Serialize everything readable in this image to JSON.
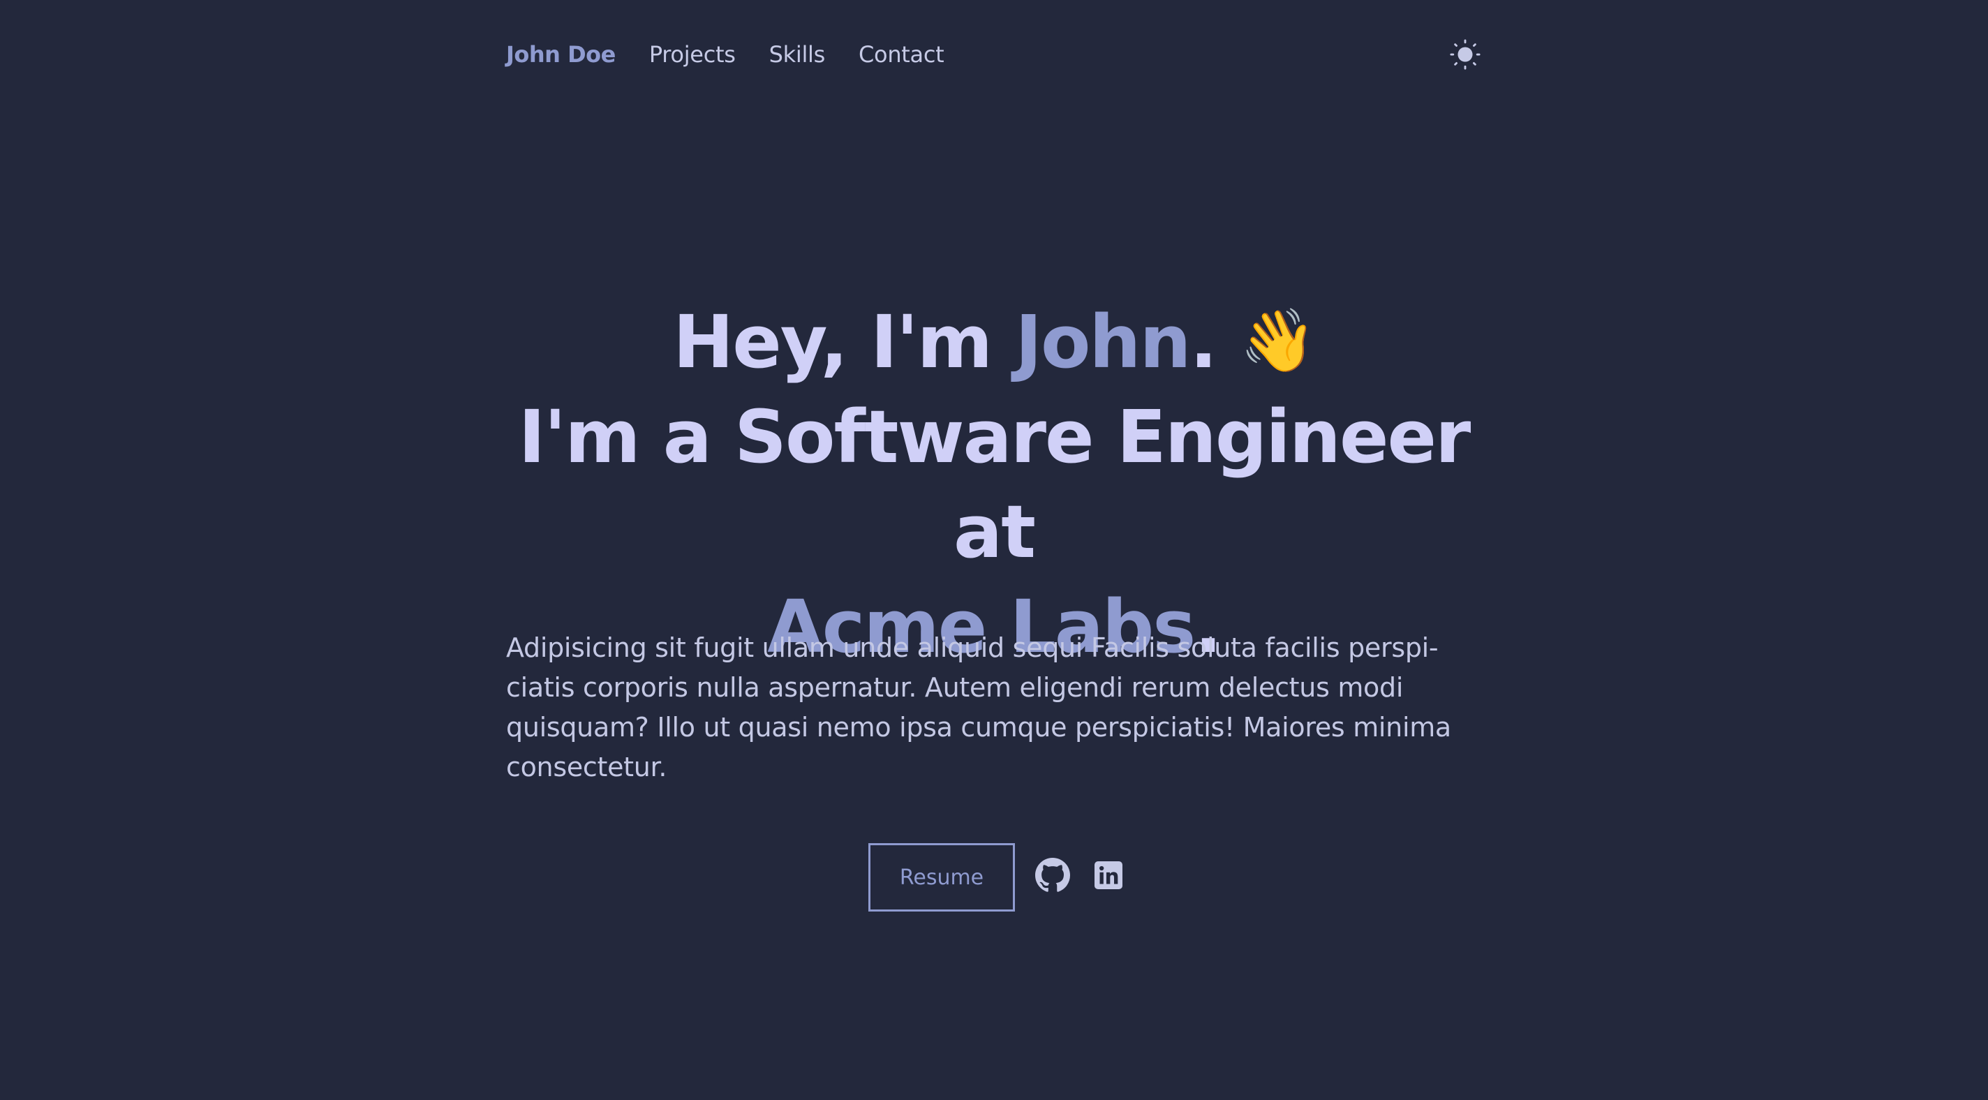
{
  "nav": {
    "brand": "John Doe",
    "links": [
      "Projects",
      "Skills",
      "Contact"
    ],
    "theme_toggle_icon": "sun-icon"
  },
  "hero": {
    "line1_prefix": "Hey, I'm ",
    "line1_name": "John",
    "line1_suffix": ".",
    "wave_emoji": "👋",
    "line2": "I'm a Software Engineer at",
    "company": "Acme Labs",
    "company_suffix": "."
  },
  "bio": "Adipisicing sit fugit ullam unde aliquid sequi Facilis soluta facilis perspi­ciatis corporis nulla aspernatur. Autem eligendi rerum delectus modi quisquam? Illo ut quasi nemo ipsa cumque perspiciatis! Maiores minima consectetur.",
  "actions": {
    "resume_label": "Resume",
    "github_icon": "github-icon",
    "linkedin_icon": "linkedin-icon"
  },
  "colors": {
    "background": "#23283c",
    "accent": "#8f9bd0",
    "heading": "#d0d0f7",
    "text": "#c4c8e4"
  }
}
